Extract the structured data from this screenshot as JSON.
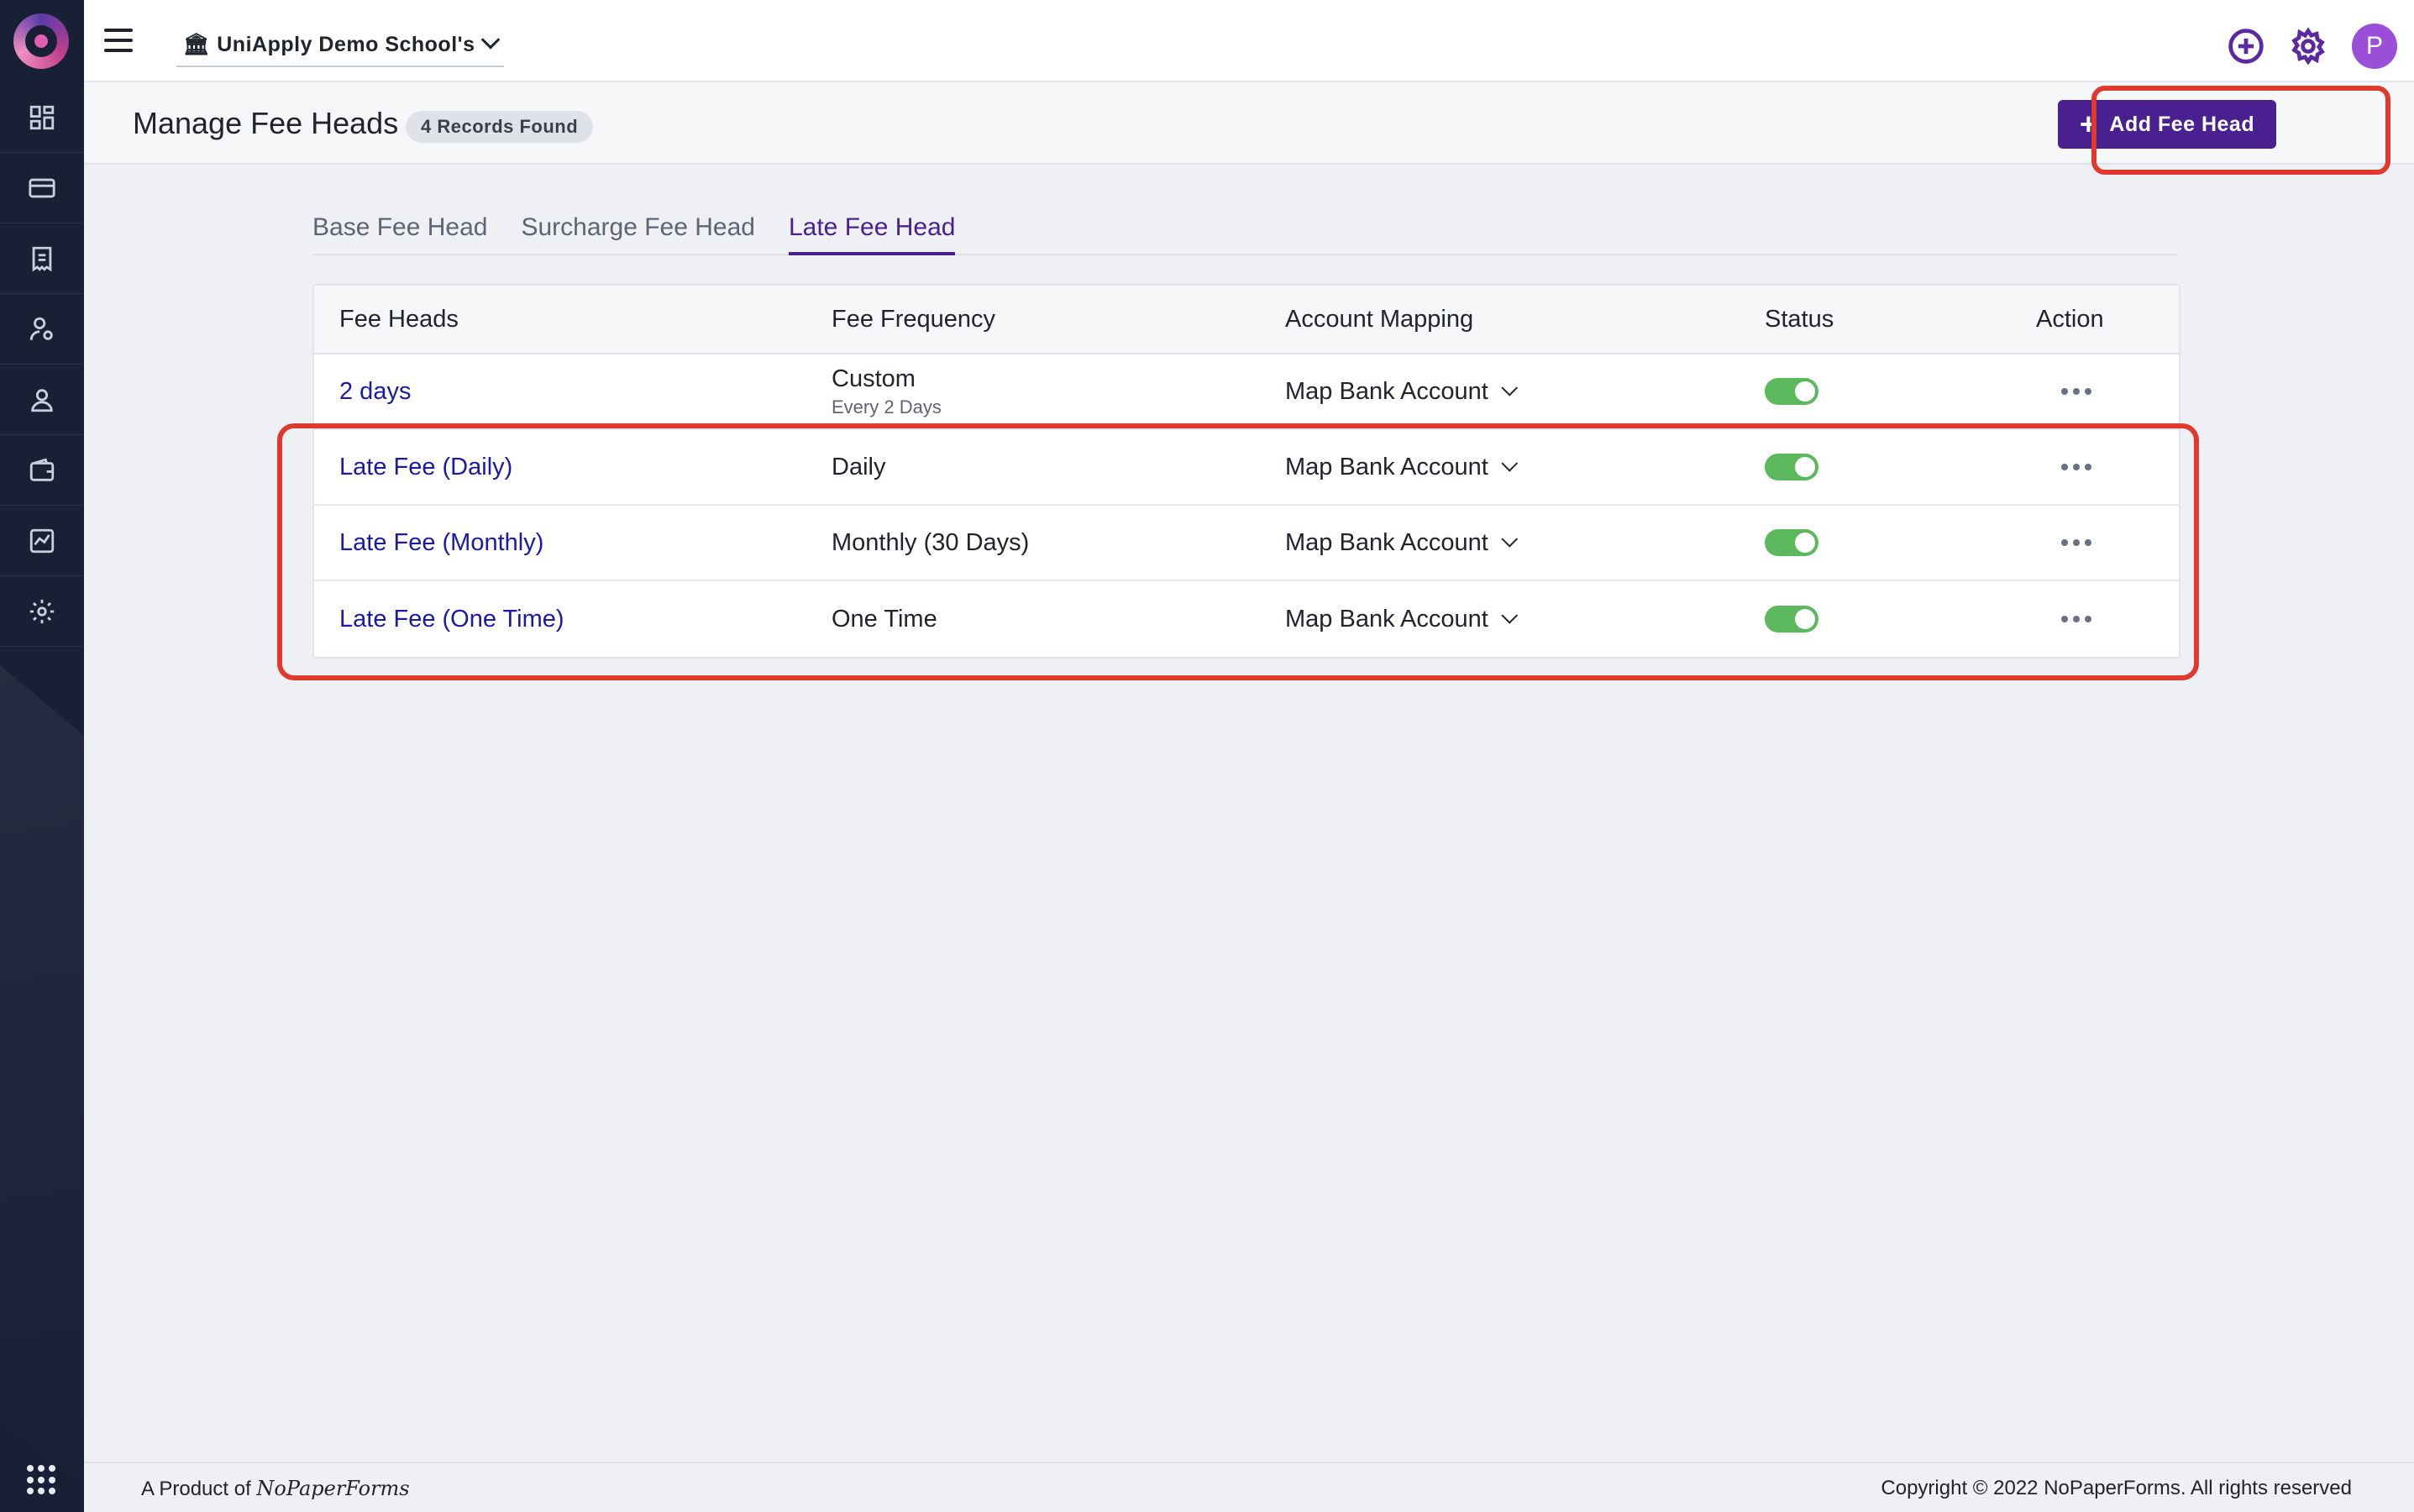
{
  "topbar": {
    "school_name": "UniApply Demo School's"
  },
  "page": {
    "title": "Manage Fee Heads",
    "records_badge": "4 Records Found",
    "add_button_label": "Add Fee Head"
  },
  "tabs": [
    {
      "label": "Base Fee Head",
      "active": false
    },
    {
      "label": "Surcharge Fee Head",
      "active": false
    },
    {
      "label": "Late Fee Head",
      "active": true
    }
  ],
  "table": {
    "headers": [
      "Fee Heads",
      "Fee Frequency",
      "Account Mapping",
      "Status",
      "Action"
    ],
    "rows": [
      {
        "fee_head": "2 days",
        "frequency": "Custom",
        "frequency_sub": "Every 2 Days",
        "account_mapping": "Map Bank Account",
        "status_on": true
      },
      {
        "fee_head": "Late Fee (Daily)",
        "frequency": "Daily",
        "frequency_sub": "",
        "account_mapping": "Map Bank Account",
        "status_on": true
      },
      {
        "fee_head": "Late Fee (Monthly)",
        "frequency": "Monthly (30 Days)",
        "frequency_sub": "",
        "account_mapping": "Map Bank Account",
        "status_on": true
      },
      {
        "fee_head": "Late Fee (One Time)",
        "frequency": "One Time",
        "frequency_sub": "",
        "account_mapping": "Map Bank Account",
        "status_on": true
      }
    ]
  },
  "footer": {
    "product_prefix": "A Product of",
    "product_brand": "NoPaperForms",
    "copyright": "Copyright © 2022 NoPaperForms. All rights reserved"
  },
  "colors": {
    "sidebar": "#182036",
    "accent": "#4a1f8f",
    "link": "#1a1aa6",
    "toggle_on": "#5cb85c",
    "highlight": "#e03a2e"
  }
}
